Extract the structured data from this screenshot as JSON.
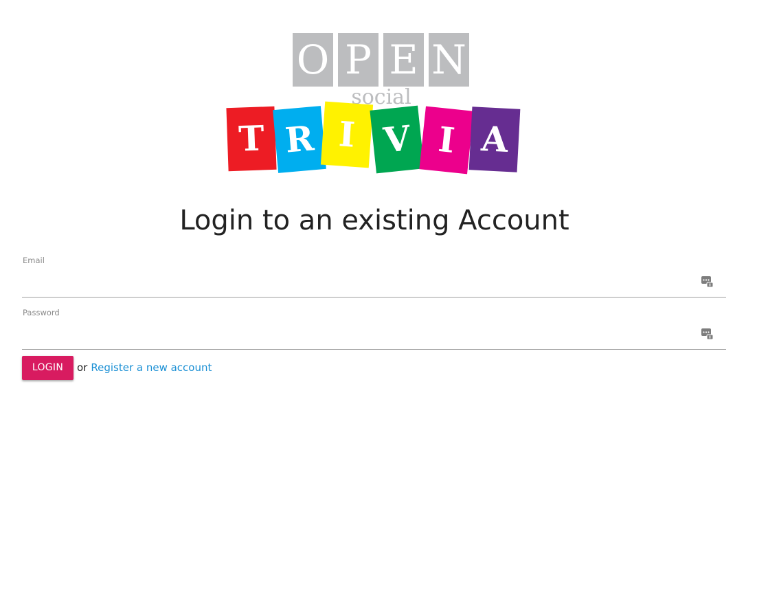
{
  "logo": {
    "open_letters": [
      "O",
      "P",
      "E",
      "N"
    ],
    "social_text": "social",
    "trivia_letters": [
      "T",
      "R",
      "I",
      "V",
      "I",
      "A"
    ],
    "trivia_colors": [
      "#ed1c24",
      "#00aeef",
      "#fff200",
      "#00a651",
      "#ec008c",
      "#662d91"
    ],
    "open_color": "#bcbdbf"
  },
  "page": {
    "title": "Login to an existing Account"
  },
  "form": {
    "email": {
      "label": "Email",
      "value": "",
      "icon": "password-manager-icon"
    },
    "password": {
      "label": "Password",
      "value": "",
      "icon": "password-manager-icon"
    },
    "login_button": "LOGIN",
    "or_text": "or",
    "register_link": "Register a new account"
  },
  "colors": {
    "accent": "#d81b60",
    "link": "#1a8fd4"
  }
}
